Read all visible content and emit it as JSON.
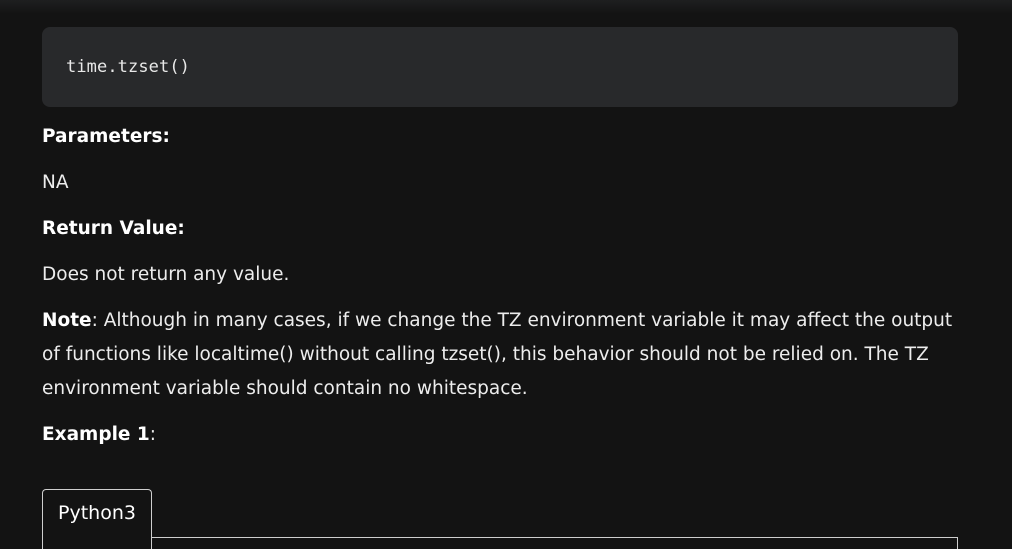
{
  "code": {
    "syntax": "time.tzset()"
  },
  "sections": {
    "parameters_heading": "Parameters:",
    "parameters_value": "NA",
    "return_heading": "Return Value:",
    "return_value": "Does not return any value.",
    "note_label": "Note",
    "note_text": ": Although in many cases, if we change the TZ environment variable it may affect the output of functions like localtime() without calling tzset(), this behavior should not be relied on. The TZ environment variable should contain no whitespace.",
    "example_label": "Example 1",
    "example_suffix": ":"
  },
  "tabs": {
    "active_label": "Python3"
  }
}
